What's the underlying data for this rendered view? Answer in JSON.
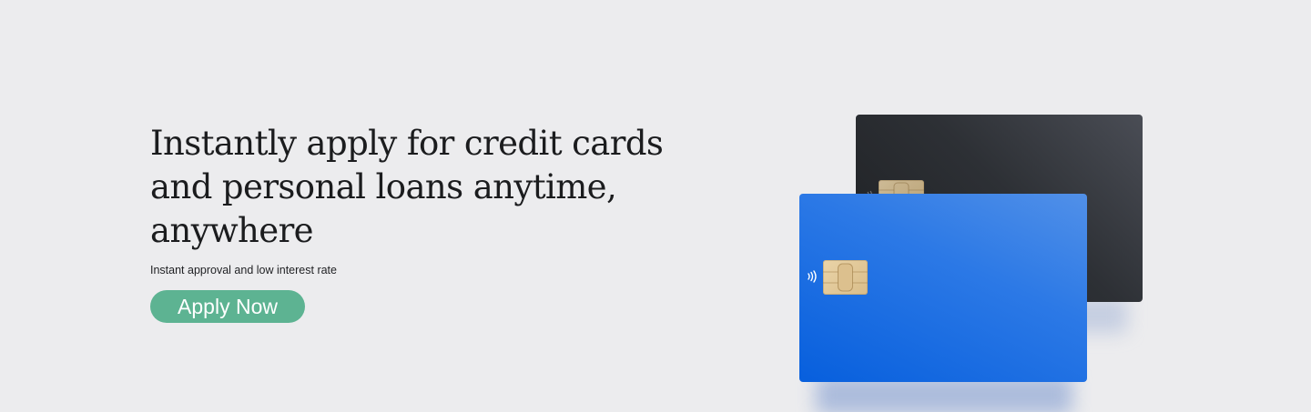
{
  "hero": {
    "headline_lines": [
      "Instantly apply for credit cards",
      "and personal loans anytime,",
      "anywhere"
    ],
    "subline": "Instant approval and low interest rate",
    "cta_label": "Apply Now"
  },
  "colors": {
    "background": "#ececee",
    "cta": "#5db392",
    "card_blue": "#1f6fe3",
    "card_dark": "#2d3035",
    "chip": "#e2c897"
  },
  "icons": {
    "chip": "card-chip-icon",
    "contactless": "contactless-icon"
  }
}
